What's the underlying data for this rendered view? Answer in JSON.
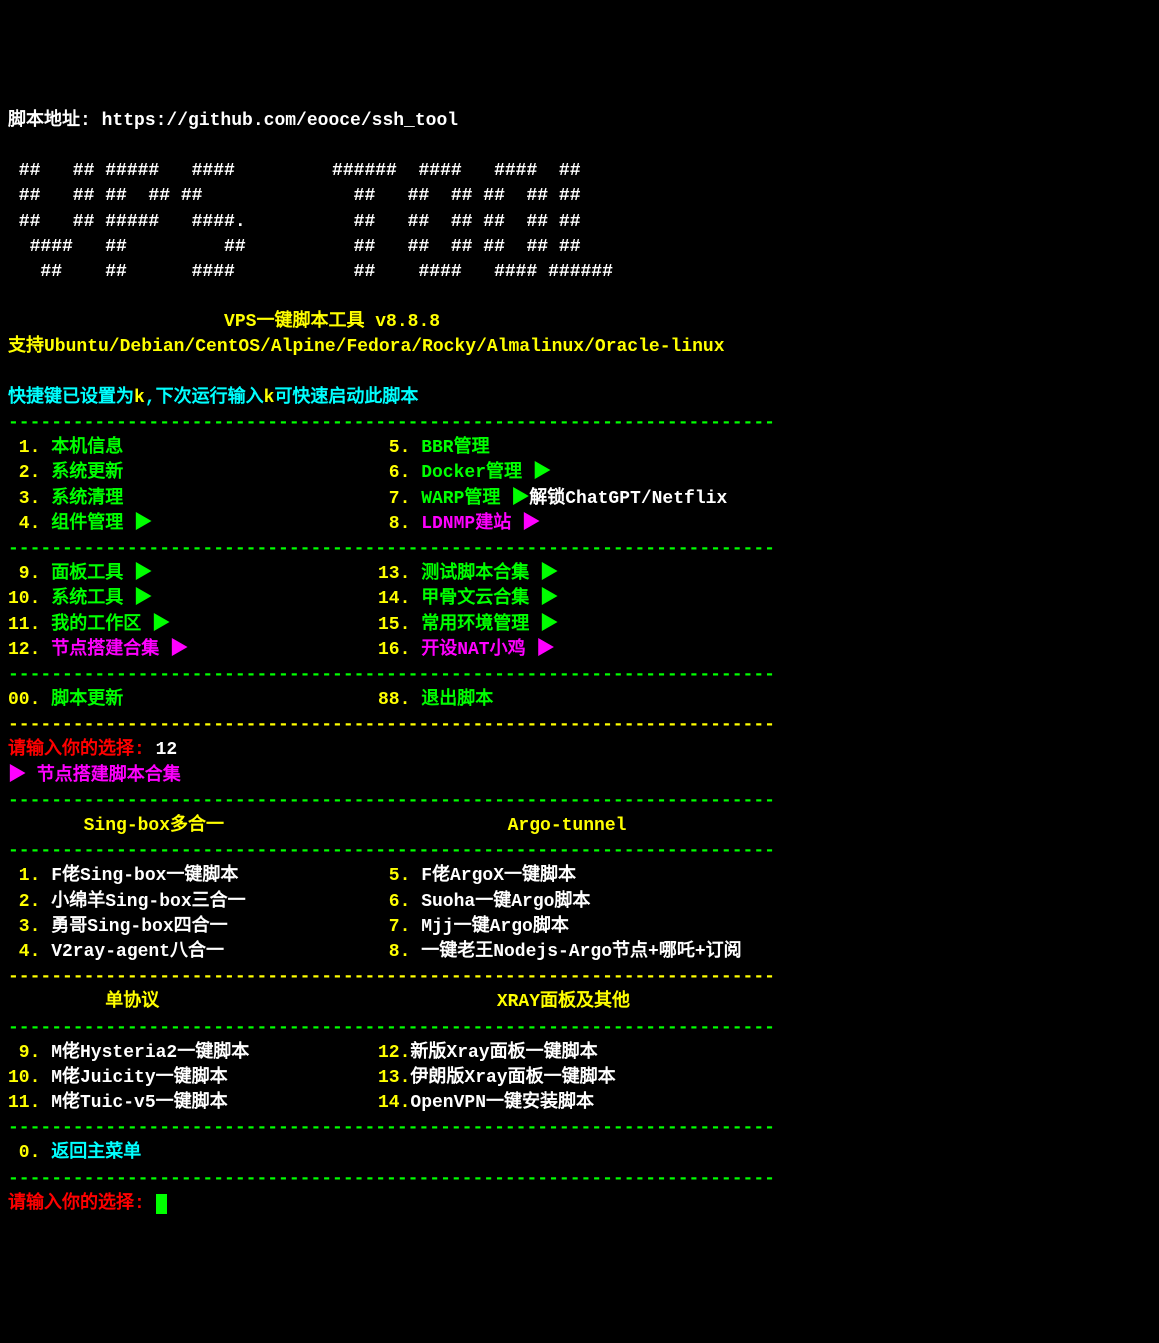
{
  "header": {
    "script_url_label": "脚本地址: ",
    "script_url": "https://github.com/eooce/ssh_tool",
    "ascii_art": " ##   ## #####   ####         ######  ####   ####  ##\n ##   ## ##  ## ##              ##   ##  ## ##  ## ##\n ##   ## #####   ####.          ##   ##  ## ##  ## ##\n  ####   ##         ##          ##   ##  ## ##  ## ##\n   ##    ##      ####           ##    ####   #### ######",
    "title_line": "                    VPS一键脚本工具 v8.8.8",
    "support_line": "支持Ubuntu/Debian/CentOS/Alpine/Fedora/Rocky/Almalinux/Oracle-linux",
    "hotkey_prefix": "快捷键已设置为",
    "hotkey_key": "k",
    "hotkey_mid": ",下次运行输入",
    "hotkey_suffix": "可快速启动此脚本"
  },
  "divider_green": "-----------------------------------------------------------------------",
  "divider_yellow": "-----------------------------------------------------------------------",
  "menu1": {
    "left": [
      {
        "num": " 1.",
        "label": " 本机信息"
      },
      {
        "num": " 2.",
        "label": " 系统更新"
      },
      {
        "num": " 3.",
        "label": " 系统清理"
      },
      {
        "num": " 4.",
        "label": " 组件管理 ▶"
      }
    ],
    "right": [
      {
        "num": " 5.",
        "label": " BBR管理"
      },
      {
        "num": " 6.",
        "label": " Docker管理 ▶"
      },
      {
        "num": " 7.",
        "label": " WARP管理 ▶",
        "suffix": "解锁ChatGPT/Netflix"
      },
      {
        "num": " 8.",
        "label": " LDNMP建站 ▶",
        "magenta": true
      }
    ]
  },
  "menu2": {
    "left": [
      {
        "num": " 9.",
        "label": " 面板工具 ▶"
      },
      {
        "num": "10.",
        "label": " 系统工具 ▶"
      },
      {
        "num": "11.",
        "label": " 我的工作区 ▶"
      },
      {
        "num": "12.",
        "label": " 节点搭建合集 ▶",
        "magenta": true
      }
    ],
    "right": [
      {
        "num": "13.",
        "label": " 测试脚本合集 ▶"
      },
      {
        "num": "14.",
        "label": " 甲骨文云合集 ▶"
      },
      {
        "num": "15.",
        "label": " 常用环境管理 ▶"
      },
      {
        "num": "16.",
        "label": " 开设NAT小鸡 ▶",
        "magenta": true
      }
    ]
  },
  "menu3": {
    "left": {
      "num": "00.",
      "label": " 脚本更新"
    },
    "right": {
      "num": "88.",
      "label": " 退出脚本"
    }
  },
  "prompt1": {
    "label": "请输入你的选择: ",
    "value": "12"
  },
  "submenu_title": "▶ 节点搭建脚本合集",
  "section_headers": {
    "singbox": "       Sing-box多合一",
    "argo": "            Argo-tunnel",
    "single": "         单协议",
    "xray": "           XRAY面板及其他"
  },
  "sub1": {
    "left": [
      {
        "num": " 1.",
        "label": " F佬Sing-box一键脚本"
      },
      {
        "num": " 2.",
        "label": " 小绵羊Sing-box三合一"
      },
      {
        "num": " 3.",
        "label": " 勇哥Sing-box四合一"
      },
      {
        "num": " 4.",
        "label": " V2ray-agent八合一"
      }
    ],
    "right": [
      {
        "num": " 5.",
        "label": " F佬ArgoX一键脚本"
      },
      {
        "num": " 6.",
        "label": " Suoha一键Argo脚本"
      },
      {
        "num": " 7.",
        "label": " Mjj一键Argo脚本"
      },
      {
        "num": " 8.",
        "label": " 一键老王Nodejs-Argo节点+哪吒+订阅"
      }
    ]
  },
  "sub2": {
    "left": [
      {
        "num": " 9.",
        "label": " M佬Hysteria2一键脚本"
      },
      {
        "num": "10.",
        "label": " M佬Juicity一键脚本"
      },
      {
        "num": "11.",
        "label": " M佬Tuic-v5一键脚本"
      }
    ],
    "right": [
      {
        "num": "12.",
        "label": "新版Xray面板一键脚本"
      },
      {
        "num": "13.",
        "label": "伊朗版Xray面板一键脚本"
      },
      {
        "num": "14.",
        "label": "OpenVPN一键安装脚本"
      }
    ]
  },
  "sub3": {
    "num": " 0.",
    "label": " 返回主菜单"
  },
  "prompt2": {
    "label": "请输入你的选择: "
  }
}
